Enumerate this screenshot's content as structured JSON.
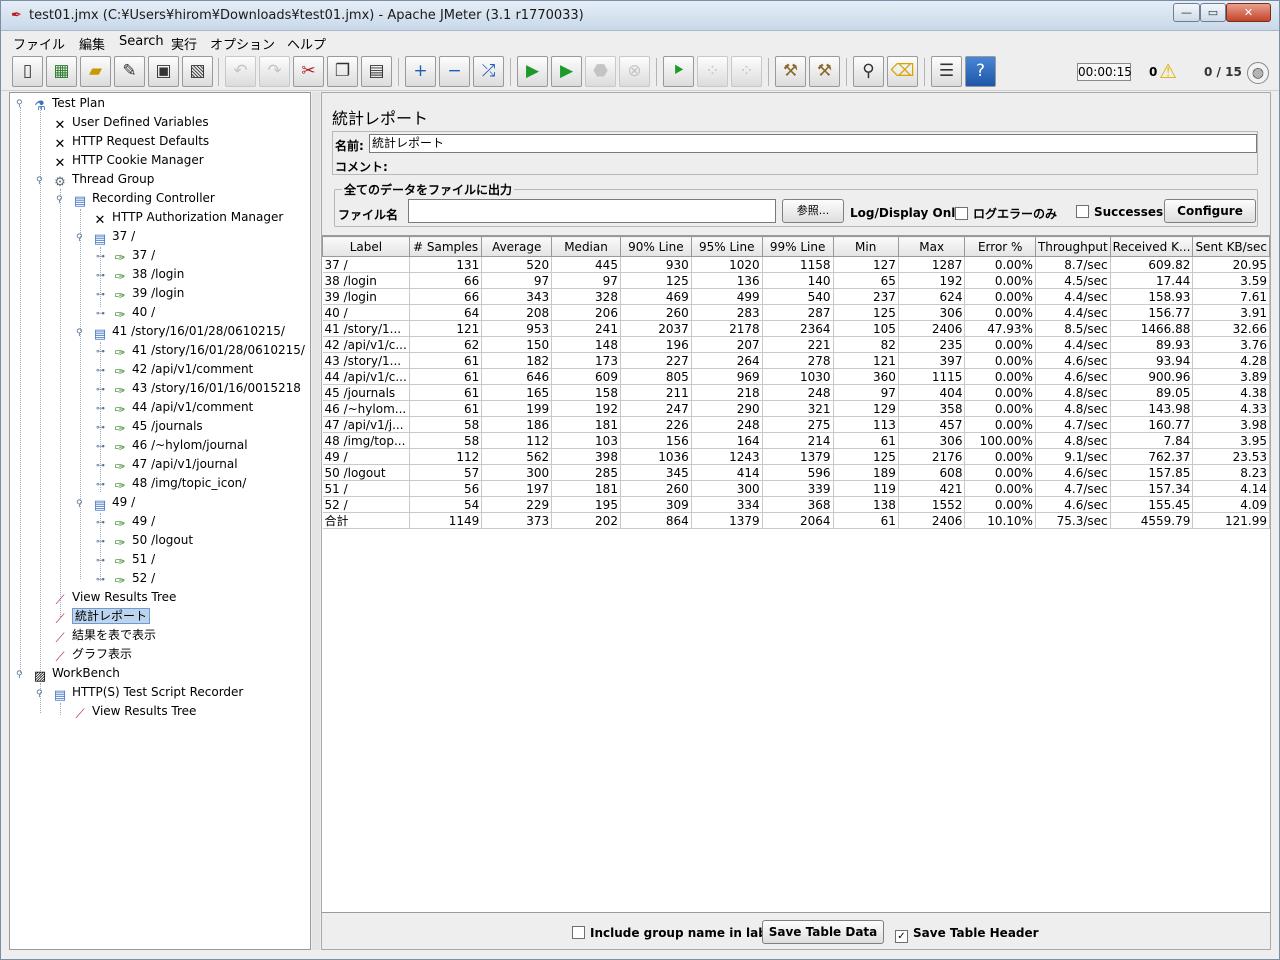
{
  "window": {
    "title": "test01.jmx (C:¥Users¥hirom¥Downloads¥test01.jmx) - Apache JMeter (3.1 r1770033)",
    "minimize_glyph": "—",
    "maximize_glyph": "▭",
    "close_glyph": "✕"
  },
  "menu": [
    "ファイル",
    "編集",
    "Search",
    "実行",
    "オプション",
    "ヘルプ"
  ],
  "status": {
    "timer": "00:00:15",
    "error_count": "0",
    "threads": "0 / 15"
  },
  "toolbar_icons": [
    "new-icon",
    "templates-icon",
    "open-icon",
    "close-file-icon",
    "save-icon",
    "save-as-icon",
    "undo-icon",
    "redo-icon",
    "cut-icon",
    "copy-icon",
    "paste-icon",
    "expand-icon",
    "collapse-icon",
    "toggle-icon",
    "start-icon",
    "start-no-pause-icon",
    "stop-icon",
    "shutdown-icon",
    "remote-start-icon",
    "remote-stop-icon",
    "remote-shutdown-icon",
    "clear-icon",
    "clear-all-icon",
    "search-icon",
    "reset-search-icon",
    "function-helper-icon",
    "help-icon"
  ],
  "tree": [
    {
      "label": "Test Plan",
      "icon": "test-plan-icon"
    },
    {
      "label": "User Defined Variables",
      "icon": "config-tool-icon"
    },
    {
      "label": "HTTP Request Defaults",
      "icon": "config-tool-icon"
    },
    {
      "label": "HTTP Cookie Manager",
      "icon": "config-tool-icon"
    },
    {
      "label": "Thread Group",
      "icon": "thread-group-icon"
    },
    {
      "label": "Recording Controller",
      "icon": "controller-icon"
    },
    {
      "label": "HTTP Authorization Manager",
      "icon": "config-tool-icon"
    },
    {
      "label": "37 /",
      "icon": "controller-icon"
    },
    {
      "label": "37 /",
      "icon": "sampler-icon"
    },
    {
      "label": "38 /login",
      "icon": "sampler-icon"
    },
    {
      "label": "39 /login",
      "icon": "sampler-icon"
    },
    {
      "label": "40 /",
      "icon": "sampler-icon"
    },
    {
      "label": "41 /story/16/01/28/0610215/",
      "icon": "controller-icon"
    },
    {
      "label": "41 /story/16/01/28/0610215/",
      "icon": "sampler-icon"
    },
    {
      "label": "42 /api/v1/comment",
      "icon": "sampler-icon"
    },
    {
      "label": "43 /story/16/01/16/0015218",
      "icon": "sampler-icon"
    },
    {
      "label": "44 /api/v1/comment",
      "icon": "sampler-icon"
    },
    {
      "label": "45 /journals",
      "icon": "sampler-icon"
    },
    {
      "label": "46 /~hylom/journal",
      "icon": "sampler-icon"
    },
    {
      "label": "47 /api/v1/journal",
      "icon": "sampler-icon"
    },
    {
      "label": "48 /img/topic_icon/",
      "icon": "sampler-icon"
    },
    {
      "label": "49 /",
      "icon": "controller-icon"
    },
    {
      "label": "49 /",
      "icon": "sampler-icon"
    },
    {
      "label": "50 /logout",
      "icon": "sampler-icon"
    },
    {
      "label": "51 /",
      "icon": "sampler-icon"
    },
    {
      "label": "52 /",
      "icon": "sampler-icon"
    },
    {
      "label": "View Results Tree",
      "icon": "listener-icon"
    },
    {
      "label": "統計レポート",
      "icon": "listener-icon"
    },
    {
      "label": "結果を表で表示",
      "icon": "listener-icon"
    },
    {
      "label": "グラフ表示",
      "icon": "listener-icon"
    },
    {
      "label": "WorkBench",
      "icon": "workbench-icon"
    },
    {
      "label": "HTTP(S) Test Script Recorder",
      "icon": "controller-icon"
    },
    {
      "label": "View Results Tree",
      "icon": "listener-icon"
    }
  ],
  "panel": {
    "title": "統計レポート",
    "name_label": "名前:",
    "name_value": "統計レポート",
    "comment_label": "コメント:",
    "file_legend": "全てのデータをファイルに出力",
    "file_label": "ファイル名",
    "browse_button": "参照...",
    "log_display_only": "Log/Display Only:",
    "log_errors_only": "ログエラーのみ",
    "successes": "Successes",
    "configure_button": "Configure"
  },
  "table": {
    "headers": [
      "Label",
      "# Samples",
      "Average",
      "Median",
      "90% Line",
      "95% Line",
      "99% Line",
      "Min",
      "Max",
      "Error %",
      "Throughput",
      "Received K...",
      "Sent KB/sec"
    ],
    "rows": [
      [
        "37 /",
        "131",
        "520",
        "445",
        "930",
        "1020",
        "1158",
        "127",
        "1287",
        "0.00%",
        "8.7/sec",
        "609.82",
        "20.95"
      ],
      [
        "38 /login",
        "66",
        "97",
        "97",
        "125",
        "136",
        "140",
        "65",
        "192",
        "0.00%",
        "4.5/sec",
        "17.44",
        "3.59"
      ],
      [
        "39 /login",
        "66",
        "343",
        "328",
        "469",
        "499",
        "540",
        "237",
        "624",
        "0.00%",
        "4.4/sec",
        "158.93",
        "7.61"
      ],
      [
        "40 /",
        "64",
        "208",
        "206",
        "260",
        "283",
        "287",
        "125",
        "306",
        "0.00%",
        "4.4/sec",
        "156.77",
        "3.91"
      ],
      [
        "41 /story/1...",
        "121",
        "953",
        "241",
        "2037",
        "2178",
        "2364",
        "105",
        "2406",
        "47.93%",
        "8.5/sec",
        "1466.88",
        "32.66"
      ],
      [
        "42 /api/v1/c...",
        "62",
        "150",
        "148",
        "196",
        "207",
        "221",
        "82",
        "235",
        "0.00%",
        "4.4/sec",
        "89.93",
        "3.76"
      ],
      [
        "43 /story/1...",
        "61",
        "182",
        "173",
        "227",
        "264",
        "278",
        "121",
        "397",
        "0.00%",
        "4.6/sec",
        "93.94",
        "4.28"
      ],
      [
        "44 /api/v1/c...",
        "61",
        "646",
        "609",
        "805",
        "969",
        "1030",
        "360",
        "1115",
        "0.00%",
        "4.6/sec",
        "900.96",
        "3.89"
      ],
      [
        "45 /journals",
        "61",
        "165",
        "158",
        "211",
        "218",
        "248",
        "97",
        "404",
        "0.00%",
        "4.8/sec",
        "89.05",
        "4.38"
      ],
      [
        "46 /~hylom...",
        "61",
        "199",
        "192",
        "247",
        "290",
        "321",
        "129",
        "358",
        "0.00%",
        "4.8/sec",
        "143.98",
        "4.33"
      ],
      [
        "47 /api/v1/j...",
        "58",
        "186",
        "181",
        "226",
        "248",
        "275",
        "113",
        "457",
        "0.00%",
        "4.7/sec",
        "160.77",
        "3.98"
      ],
      [
        "48 /img/top...",
        "58",
        "112",
        "103",
        "156",
        "164",
        "214",
        "61",
        "306",
        "100.00%",
        "4.8/sec",
        "7.84",
        "3.95"
      ],
      [
        "49 /",
        "112",
        "562",
        "398",
        "1036",
        "1243",
        "1379",
        "125",
        "2176",
        "0.00%",
        "9.1/sec",
        "762.37",
        "23.53"
      ],
      [
        "50 /logout",
        "57",
        "300",
        "285",
        "345",
        "414",
        "596",
        "189",
        "608",
        "0.00%",
        "4.6/sec",
        "157.85",
        "8.23"
      ],
      [
        "51 /",
        "56",
        "197",
        "181",
        "260",
        "300",
        "339",
        "119",
        "421",
        "0.00%",
        "4.7/sec",
        "157.34",
        "4.14"
      ],
      [
        "52 /",
        "54",
        "229",
        "195",
        "309",
        "334",
        "368",
        "138",
        "1552",
        "0.00%",
        "4.6/sec",
        "155.45",
        "4.09"
      ],
      [
        "合計",
        "1149",
        "373",
        "202",
        "864",
        "1379",
        "2064",
        "61",
        "2406",
        "10.10%",
        "75.3/sec",
        "4559.79",
        "121.99"
      ]
    ]
  },
  "bottom": {
    "include_group": "Include group name in label?",
    "save_table_data": "Save Table Data",
    "save_table_header": "Save Table Header",
    "check_mark": "✓"
  }
}
